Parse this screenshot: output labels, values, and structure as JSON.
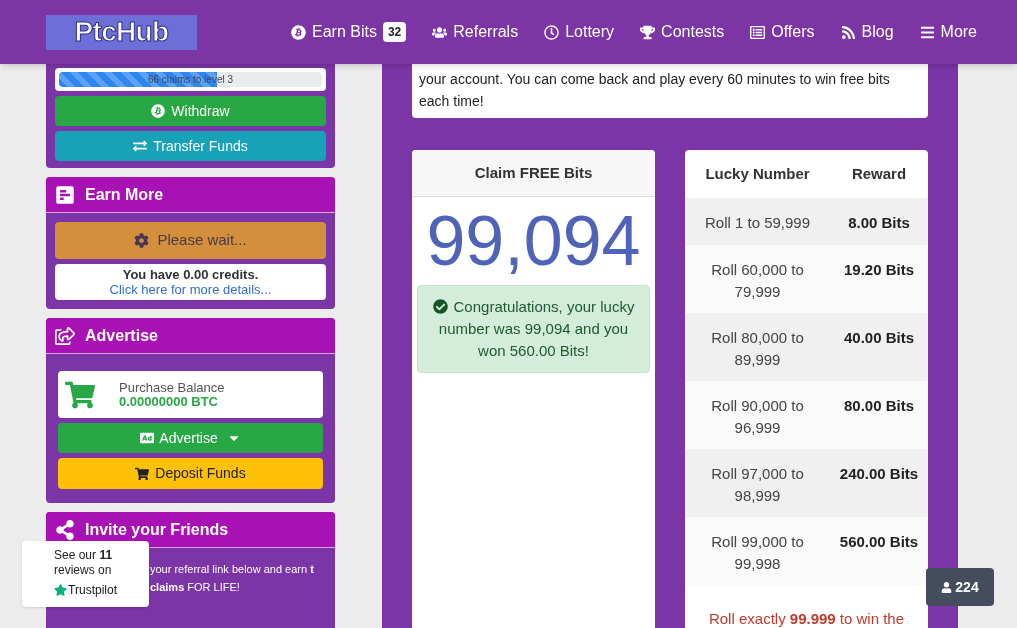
{
  "nav": {
    "logo": "PtcHub",
    "items": [
      {
        "label": "Earn Bits",
        "badge": "32"
      },
      {
        "label": "Referrals"
      },
      {
        "label": "Lottery"
      },
      {
        "label": "Contests"
      },
      {
        "label": "Offers"
      },
      {
        "label": "Blog"
      },
      {
        "label": "More"
      }
    ]
  },
  "account_card": {
    "progress": {
      "label": "66 claims to level 3",
      "level": 0.6
    },
    "buttons": [
      "Withdraw",
      "Transfer Funds"
    ]
  },
  "earn_more": {
    "title": "Earn More",
    "button": "Please wait...",
    "credits": "You have 0.00 credits.",
    "link": "Click here for more details..."
  },
  "advertise": {
    "title": "Advertise",
    "balance_label": "Purchase Balance",
    "balance": "0.00000000 BTC",
    "buttons": [
      "Advertise",
      "Deposit Funds"
    ]
  },
  "invite": {
    "title": "Invite your Friends",
    "text": "your referral link below and earn **t claims** FOR LIFE!"
  },
  "notice": "your account. You can come back and play every 60 minutes to win free bits each time!",
  "claim": {
    "title": "Claim FREE Bits",
    "number": "99,094",
    "message": "Congratulations, your lucky number was 99,094 and you won 560.00 Bits!"
  },
  "rewards": {
    "columns": [
      "Lucky Number",
      "Reward"
    ],
    "rows": [
      {
        "range": "Roll 1 to 59,999",
        "reward": "8.00 Bits"
      },
      {
        "range": "Roll 60,000 to 79,999",
        "reward": "19.20 Bits"
      },
      {
        "range": "Roll 80,000 to 89,999",
        "reward": "40.00 Bits"
      },
      {
        "range": "Roll 90,000 to 96,999",
        "reward": "80.00 Bits"
      },
      {
        "range": "Roll 97,000 to 98,999",
        "reward": "240.00 Bits"
      },
      {
        "range": "Roll 99,000 to 99,998",
        "reward": "560.00 Bits"
      }
    ],
    "footer": "Roll exactly **99.999** to win the"
  },
  "trustpilot": {
    "text": "See our **11** reviews on",
    "brand": "Trustpilot"
  },
  "online_badge": "224"
}
